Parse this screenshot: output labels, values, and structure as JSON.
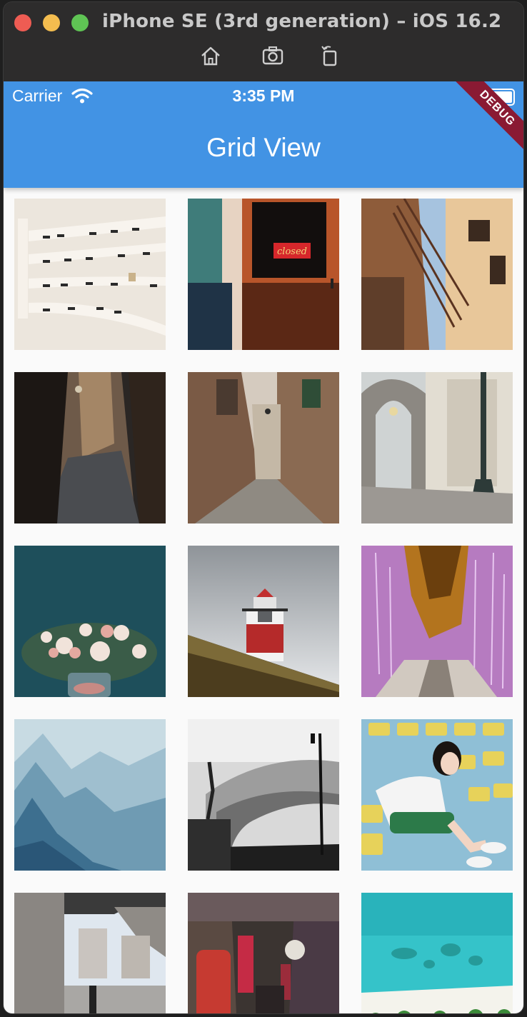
{
  "window": {
    "title": "iPhone SE (3rd generation) – iOS 16.2",
    "toolbar_icons": [
      "home-icon",
      "screenshot-icon",
      "rotate-icon"
    ]
  },
  "status_bar": {
    "carrier": "Carrier",
    "time": "3:35 PM",
    "icons": [
      "wifi-icon",
      "battery-icon"
    ]
  },
  "app_bar": {
    "title": "Grid View",
    "color": "#4293e4"
  },
  "debug_banner": {
    "label": "DEBUG"
  },
  "grid": {
    "columns": 3,
    "images": [
      {
        "name": "sunglasses-shelves-photo",
        "sign_text": ""
      },
      {
        "name": "closed-door-photo",
        "sign_text": "closed"
      },
      {
        "name": "balconies-street-photo",
        "sign_text": ""
      },
      {
        "name": "dark-alley-photo",
        "sign_text": ""
      },
      {
        "name": "cobblestone-street-photo",
        "sign_text": ""
      },
      {
        "name": "arcade-lamp-post-photo",
        "sign_text": ""
      },
      {
        "name": "flower-vase-photo",
        "sign_text": ""
      },
      {
        "name": "lighthouse-photo",
        "sign_text": ""
      },
      {
        "name": "purple-forest-photo",
        "sign_text": ""
      },
      {
        "name": "misty-mountains-photo",
        "sign_text": ""
      },
      {
        "name": "bw-curved-building-photo",
        "sign_text": ""
      },
      {
        "name": "stadium-seats-woman-photo",
        "sign_text": ""
      },
      {
        "name": "underpass-city-photo",
        "sign_text": ""
      },
      {
        "name": "neon-alley-photo",
        "sign_text": ""
      },
      {
        "name": "beach-aerial-photo",
        "sign_text": ""
      }
    ]
  }
}
